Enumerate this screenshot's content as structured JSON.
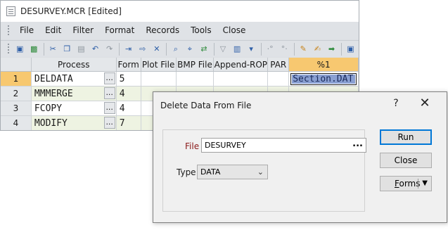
{
  "window": {
    "title": "DESURVEY.MCR [Edited]"
  },
  "menu": [
    "File",
    "Edit",
    "Filter",
    "Format",
    "Records",
    "Tools",
    "Close"
  ],
  "toolbar_icons": [
    {
      "name": "save-icon",
      "glyph": "▣",
      "tone": ""
    },
    {
      "name": "excel-icon",
      "glyph": "▩",
      "tone": "green"
    },
    {
      "sep": true
    },
    {
      "name": "cut-icon",
      "glyph": "✂",
      "tone": ""
    },
    {
      "name": "copy-icon",
      "glyph": "❐",
      "tone": ""
    },
    {
      "name": "paste-icon",
      "glyph": "▤",
      "tone": "gray"
    },
    {
      "name": "undo-icon",
      "glyph": "↶",
      "tone": ""
    },
    {
      "name": "redo-icon",
      "glyph": "↷",
      "tone": "gray"
    },
    {
      "sep": true
    },
    {
      "name": "insert-row-icon",
      "glyph": "⇥",
      "tone": ""
    },
    {
      "name": "append-row-icon",
      "glyph": "⇨",
      "tone": ""
    },
    {
      "name": "delete-row-icon",
      "glyph": "✕",
      "tone": ""
    },
    {
      "sep": true
    },
    {
      "name": "find-icon",
      "glyph": "⌕",
      "tone": ""
    },
    {
      "name": "find-next-icon",
      "glyph": "⌖",
      "tone": ""
    },
    {
      "name": "replace-icon",
      "glyph": "⇄",
      "tone": "green"
    },
    {
      "sep": true
    },
    {
      "name": "filter-icon",
      "glyph": "▽",
      "tone": "gray"
    },
    {
      "name": "columns-icon",
      "glyph": "▥",
      "tone": ""
    },
    {
      "name": "dropdown-icon",
      "glyph": "▾",
      "tone": ""
    },
    {
      "sep": true
    },
    {
      "name": "decimal-increase-icon",
      "glyph": "·°",
      "tone": "gray"
    },
    {
      "name": "decimal-decrease-icon",
      "glyph": "°·",
      "tone": "gray"
    },
    {
      "sep": true
    },
    {
      "name": "edit-form-icon",
      "glyph": "✎",
      "tone": "orange"
    },
    {
      "name": "new-form-icon",
      "glyph": "✍",
      "tone": "orange"
    },
    {
      "name": "run-icon",
      "glyph": "➡",
      "tone": "green"
    },
    {
      "sep": true
    },
    {
      "name": "more-icon",
      "glyph": "▣",
      "tone": ""
    }
  ],
  "grid": {
    "headers": [
      "Process",
      "Form",
      "Plot File",
      "BMP File",
      "Append-ROP",
      "PAR",
      "%1"
    ],
    "rows": [
      {
        "num": "1",
        "process": "DELDATA",
        "form": "5",
        "extra": "Section.DAT"
      },
      {
        "num": "2",
        "process": "MMMERGE",
        "form": "4",
        "extra": ""
      },
      {
        "num": "3",
        "process": "FCOPY",
        "form": "4",
        "extra": ""
      },
      {
        "num": "4",
        "process": "MODIFY",
        "form": "7",
        "extra": ""
      }
    ],
    "ellipsis": "..."
  },
  "dialog": {
    "title": "Delete Data From File",
    "help": "?",
    "close": "✕",
    "file_label": "File",
    "file_value": "DESURVEY",
    "file_browse": "...",
    "type_label": "Type",
    "type_value": "DATA",
    "buttons": {
      "run": "Run",
      "close": "Close",
      "forms_pre": "",
      "forms_u": "F",
      "forms_rest": "orms"
    }
  }
}
